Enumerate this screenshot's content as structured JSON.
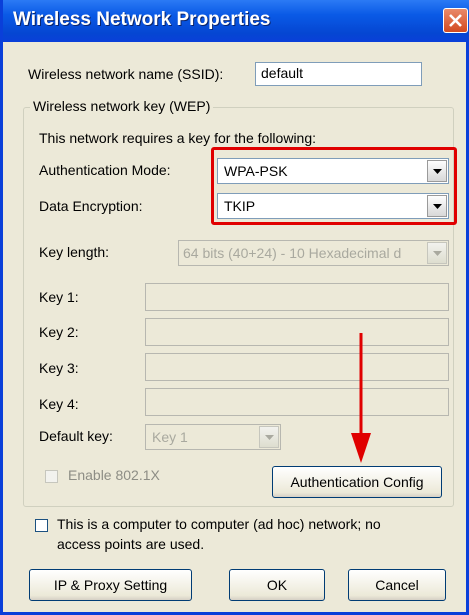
{
  "window": {
    "title": "Wireless Network Properties"
  },
  "ssid": {
    "label": "Wireless network name (SSID):",
    "value": "default"
  },
  "wep_group": {
    "legend": "Wireless network key (WEP)",
    "requires_text": "This network requires a key for the following:",
    "auth_mode": {
      "label": "Authentication Mode:",
      "value": "WPA-PSK"
    },
    "data_encryption": {
      "label": "Data Encryption:",
      "value": "TKIP"
    },
    "key_length": {
      "label": "Key length:",
      "value": "64 bits (40+24) - 10 Hexadecimal d"
    },
    "keys": [
      {
        "label": "Key 1:",
        "value": ""
      },
      {
        "label": "Key 2:",
        "value": ""
      },
      {
        "label": "Key 3:",
        "value": ""
      },
      {
        "label": "Key 4:",
        "value": ""
      }
    ],
    "default_key": {
      "label": "Default key:",
      "value": "Key 1"
    },
    "enable_8021x": {
      "label": "Enable 802.1X",
      "checked": false
    },
    "auth_config_button": "Authentication Config"
  },
  "adhoc": {
    "label_line1": "This is a computer to computer (ad hoc) network; no",
    "label_line2": "access points are used.",
    "checked": false
  },
  "buttons": {
    "ip_proxy": "IP & Proxy Setting",
    "ok": "OK",
    "cancel": "Cancel"
  },
  "colors": {
    "titlebar": "#0a5ae6",
    "highlight": "#e00000",
    "dialog_bg": "#ece9d8"
  }
}
